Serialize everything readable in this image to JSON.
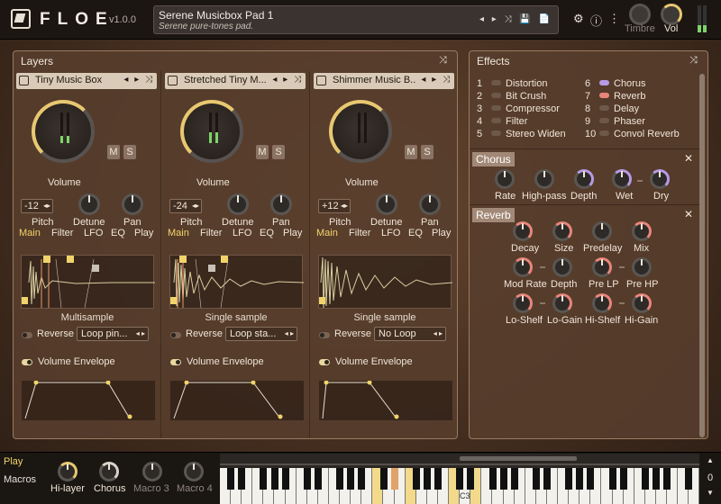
{
  "app": {
    "brand": "FLOE",
    "version": "v1.0.0"
  },
  "preset": {
    "name": "Serene Musicbox Pad 1",
    "description": "Serene pure-tones pad.",
    "icons": "◂ ▸ ⤨ 💾 📄"
  },
  "top_right": {
    "timbre_label": "Timbre",
    "vol_label": "Vol",
    "gear": "⚙",
    "info": "ⓘ",
    "more": "⋮"
  },
  "layers": {
    "title": "Layers",
    "shuffle": "⤨",
    "items": [
      {
        "name": "Tiny Music Box",
        "pitch": "-12",
        "volume_label": "Volume",
        "pitch_label": "Pitch",
        "detune_label": "Detune",
        "pan_label": "Pan",
        "m": "M",
        "s": "S",
        "wave_label": "Multisample",
        "reverse_label": "Reverse",
        "loop": "Loop pin...",
        "env_label": "Volume Envelope",
        "arrows": "◂ ▸ ⤨"
      },
      {
        "name": "Stretched Tiny M...",
        "pitch": "-24",
        "volume_label": "Volume",
        "pitch_label": "Pitch",
        "detune_label": "Detune",
        "pan_label": "Pan",
        "m": "M",
        "s": "S",
        "wave_label": "Single sample",
        "reverse_label": "Reverse",
        "loop": "Loop sta...",
        "env_label": "Volume Envelope",
        "arrows": "◂ ▸ ⤨"
      },
      {
        "name": "Shimmer Music B...",
        "pitch": "+12",
        "volume_label": "Volume",
        "pitch_label": "Pitch",
        "detune_label": "Detune",
        "pan_label": "Pan",
        "m": "M",
        "s": "S",
        "wave_label": "Single sample",
        "reverse_label": "Reverse",
        "loop": "No Loop",
        "env_label": "Volume Envelope",
        "arrows": "◂ ▸ ⤨"
      }
    ],
    "tabs": [
      "Main",
      "Filter",
      "LFO",
      "EQ",
      "Play"
    ]
  },
  "effects": {
    "title": "Effects",
    "shuffle": "⤨",
    "list_left": [
      {
        "n": "1",
        "label": "Distortion"
      },
      {
        "n": "2",
        "label": "Bit Crush"
      },
      {
        "n": "3",
        "label": "Compressor"
      },
      {
        "n": "4",
        "label": "Filter"
      },
      {
        "n": "5",
        "label": "Stereo Widen"
      }
    ],
    "list_right": [
      {
        "n": "6",
        "label": "Chorus"
      },
      {
        "n": "7",
        "label": "Reverb"
      },
      {
        "n": "8",
        "label": "Delay"
      },
      {
        "n": "9",
        "label": "Phaser"
      },
      {
        "n": "10",
        "label": "Convol Reverb"
      }
    ],
    "chorus": {
      "title": "Chorus",
      "close": "✕",
      "knobs": [
        "Rate",
        "High-pass",
        "Depth",
        "Wet",
        "Dry"
      ]
    },
    "reverb": {
      "title": "Reverb",
      "close": "✕",
      "row1": [
        "Decay",
        "Size",
        "Predelay",
        "Mix"
      ],
      "row2": [
        "Mod Rate",
        "Depth",
        "Pre LP",
        "Pre HP"
      ],
      "row3": [
        "Lo-Shelf",
        "Lo-Gain",
        "Hi-Shelf",
        "Hi-Gain"
      ]
    }
  },
  "bottom": {
    "play": "Play",
    "macros": "Macros",
    "macro_knobs": [
      "Hi-layer",
      "Chorus",
      "Macro 3",
      "Macro 4"
    ],
    "key_label": "C3",
    "octave": "0",
    "up": "▲",
    "down": "▼"
  }
}
